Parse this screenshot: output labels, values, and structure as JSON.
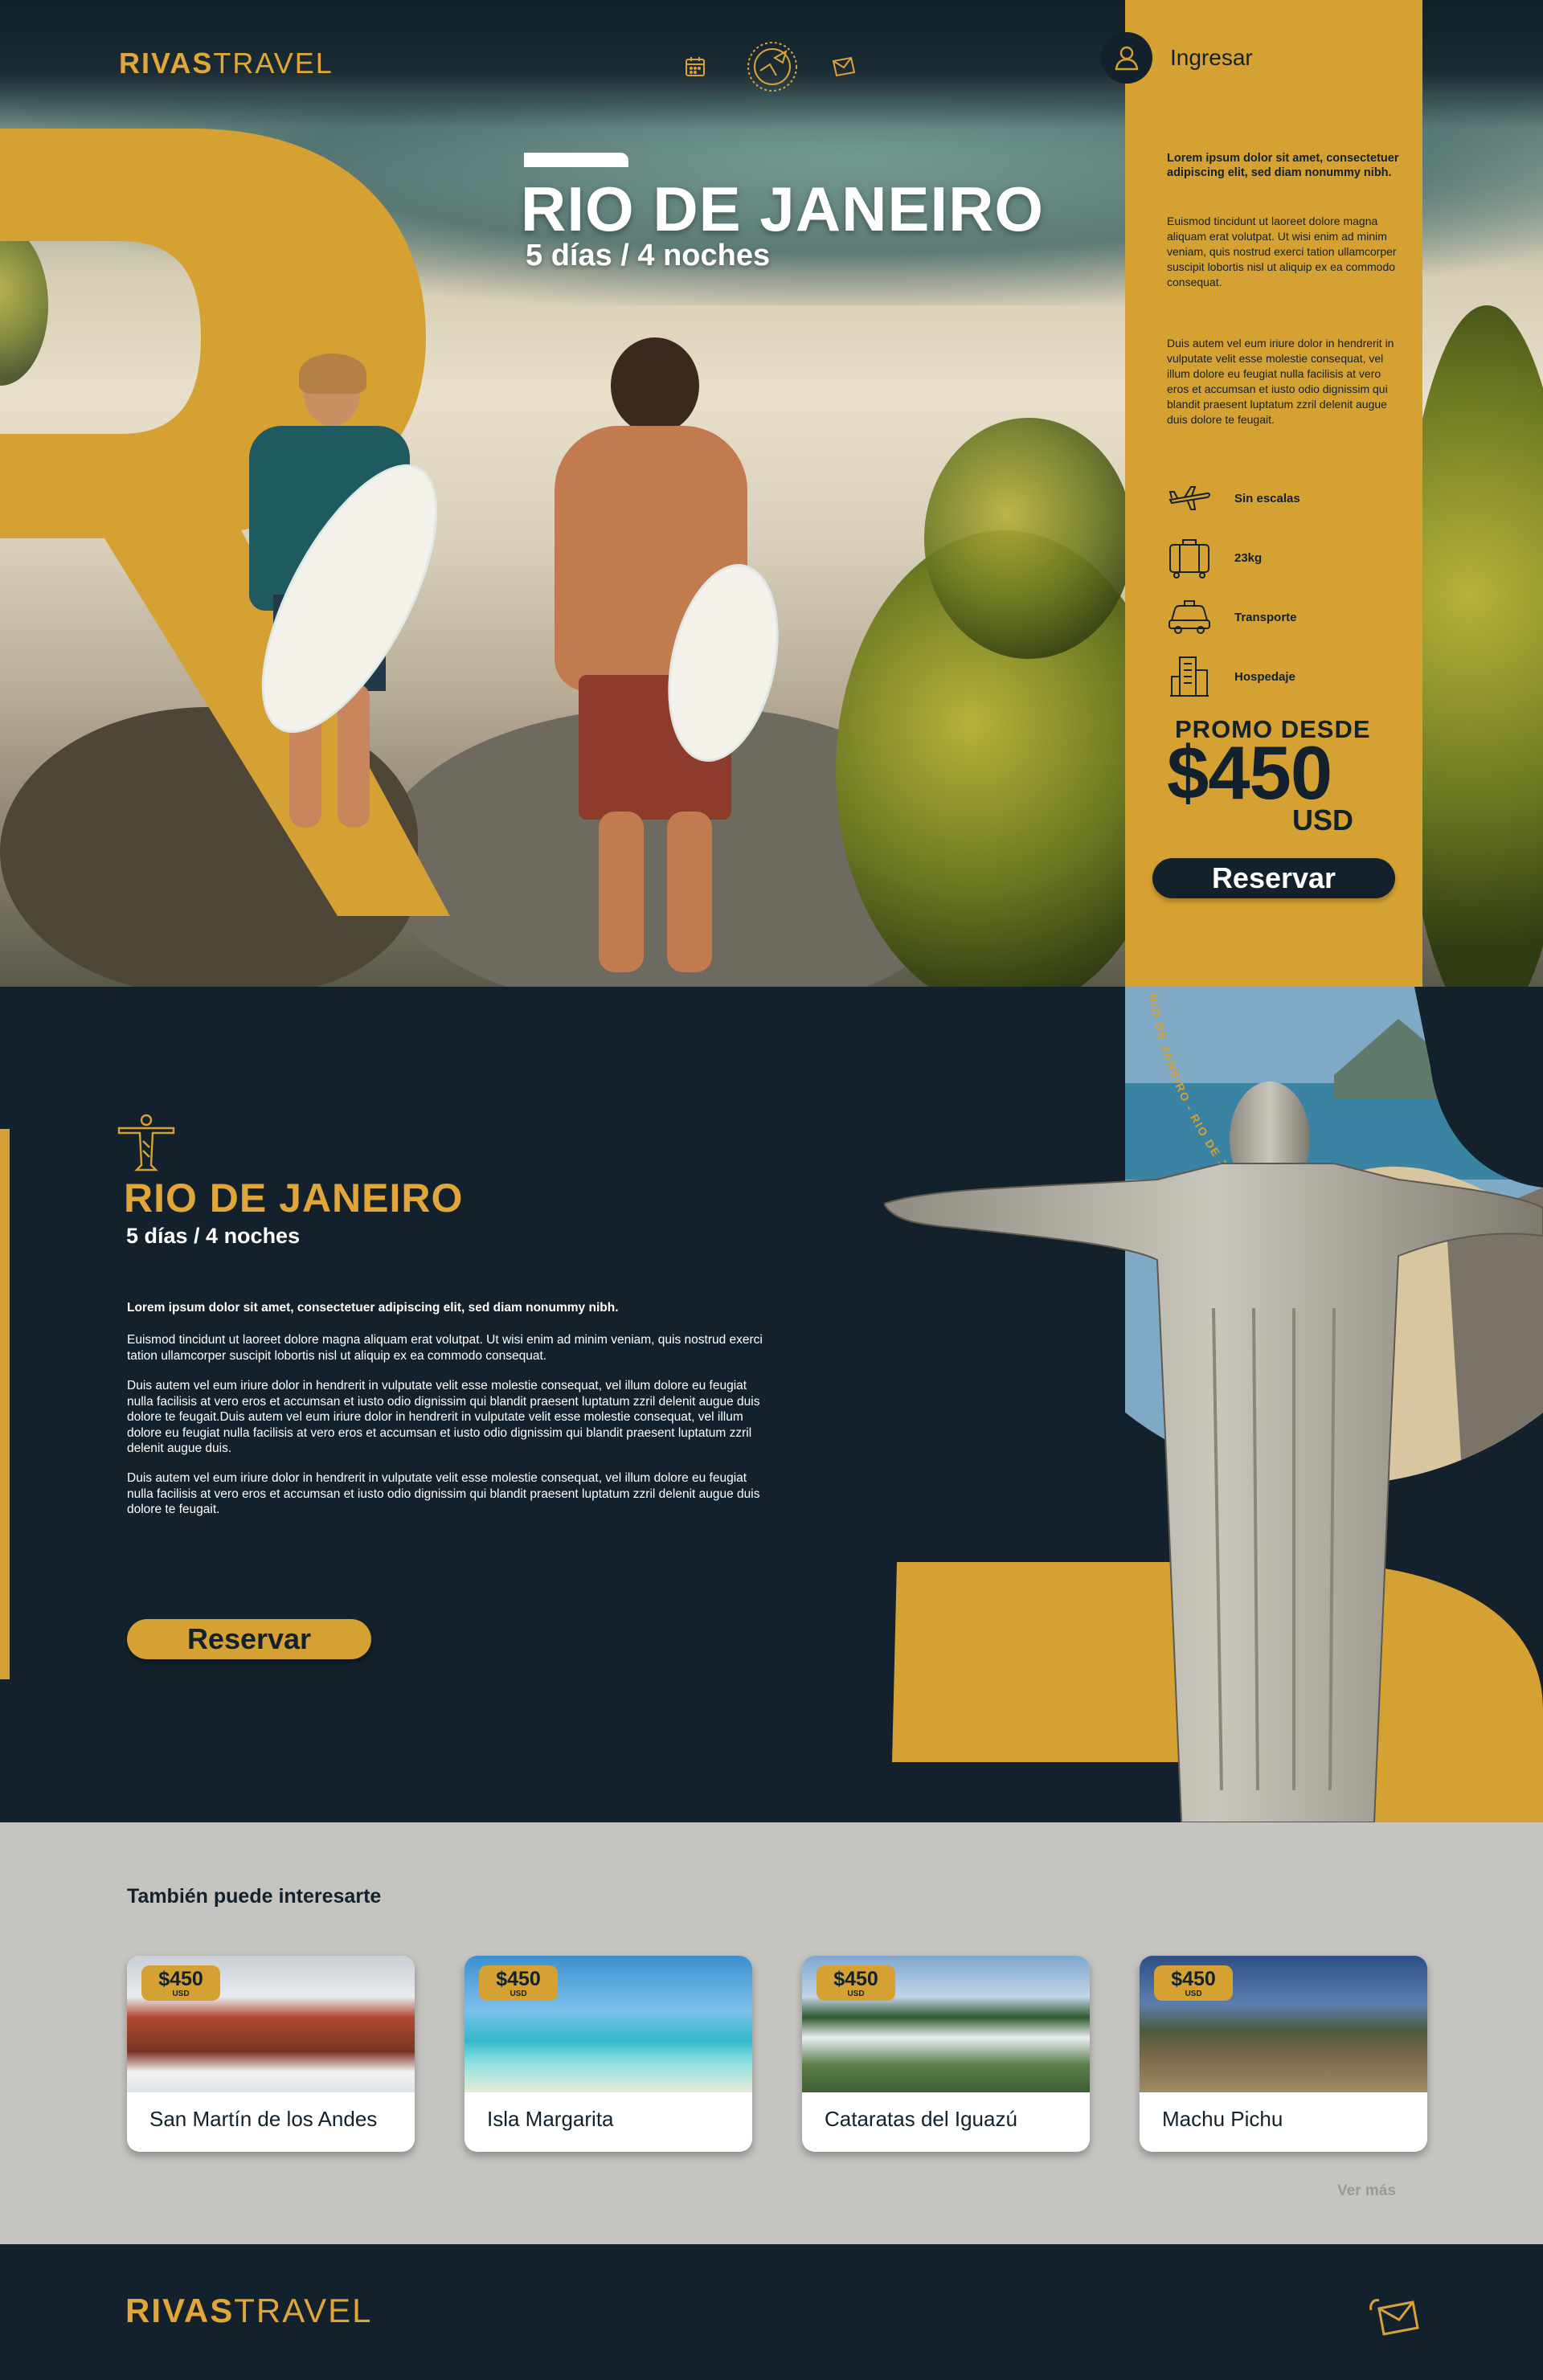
{
  "brand": {
    "strong": "RIVAS",
    "light": "TRAVEL"
  },
  "nav": {
    "icons": [
      "calendar-icon",
      "plane-globe-icon",
      "envelope-icon"
    ]
  },
  "login": {
    "label": "Ingresar",
    "icon": "user-icon"
  },
  "hero": {
    "title": "RIO DE JANEIRO",
    "subtitle": "5 días / 4 noches"
  },
  "panel": {
    "lead": "Lorem ipsum dolor sit amet, consectetuer adipiscing elit, sed diam nonummy nibh.",
    "p1": "Euismod tincidunt ut laoreet dolore magna aliquam erat volutpat. Ut wisi enim ad minim veniam, quis nostrud exerci tation ullamcorper suscipit lobortis nisl ut aliquip ex ea commodo consequat.",
    "p2": "Duis autem vel eum iriure dolor in hendrerit in vulputate velit esse molestie consequat, vel illum dolore eu feugiat nulla facilisis at vero eros et accumsan et iusto odio dignissim qui blandit praesent luptatum zzril delenit augue duis dolore te feugait.",
    "features": [
      {
        "icon": "plane-icon",
        "label": "Sin escalas"
      },
      {
        "icon": "luggage-icon",
        "label": "23kg"
      },
      {
        "icon": "car-icon",
        "label": "Transporte"
      },
      {
        "icon": "building-icon",
        "label": "Hospedaje"
      }
    ],
    "promo_label": "PROMO DESDE",
    "price": "$450",
    "currency": "USD",
    "cta": "Reservar"
  },
  "detail": {
    "title": "RIO DE JANEIRO",
    "subtitle": "5 días / 4 noches",
    "lead": "Lorem ipsum dolor sit amet, consectetuer adipiscing elit, sed diam nonummy nibh.",
    "p1": "Euismod tincidunt ut laoreet dolore magna aliquam erat volutpat. Ut wisi enim ad minim veniam, quis nostrud exerci tation ullamcorper suscipit lobortis nisl ut aliquip ex ea commodo consequat.",
    "p2": "Duis autem vel eum iriure dolor in hendrerit in vulputate velit esse molestie consequat, vel illum dolore eu feugiat nulla facilisis at vero eros et accumsan et iusto odio dignissim qui blandit praesent luptatum zzril delenit augue duis dolore te feugait.Duis autem vel eum iriure dolor in hendrerit in vulputate velit esse molestie consequat, vel illum dolore eu feugiat nulla facilisis at vero eros et accumsan et iusto odio dignissim qui blandit praesent luptatum zzril delenit augue duis.",
    "p3": "Duis autem vel eum iriure dolor in hendrerit in vulputate velit esse molestie consequat, vel illum dolore eu feugiat nulla facilisis at vero eros et accumsan et iusto odio dignissim qui blandit praesent luptatum zzril delenit augue duis dolore te feugait.",
    "curve_text": "RIO DE JANEIRO - RIO DE JANEIRO - RIO DE JANEIRO",
    "cta": "Reservar"
  },
  "suggestions": {
    "title": "También puede interesarte",
    "cards": [
      {
        "name": "San Martín de los Andes",
        "price": "$450",
        "currency": "USD"
      },
      {
        "name": "Isla Margarita",
        "price": "$450",
        "currency": "USD"
      },
      {
        "name": "Cataratas del Iguazú",
        "price": "$450",
        "currency": "USD"
      },
      {
        "name": "Machu Pichu",
        "price": "$450",
        "currency": "USD"
      }
    ],
    "more": "Ver más"
  },
  "footer": {
    "brand_strong": "RIVAS",
    "brand_light": "TRAVEL",
    "icon": "envelope-icon"
  },
  "colors": {
    "navy": "#12212b",
    "gold": "#d6a133",
    "gray": "#c6c4c1"
  }
}
